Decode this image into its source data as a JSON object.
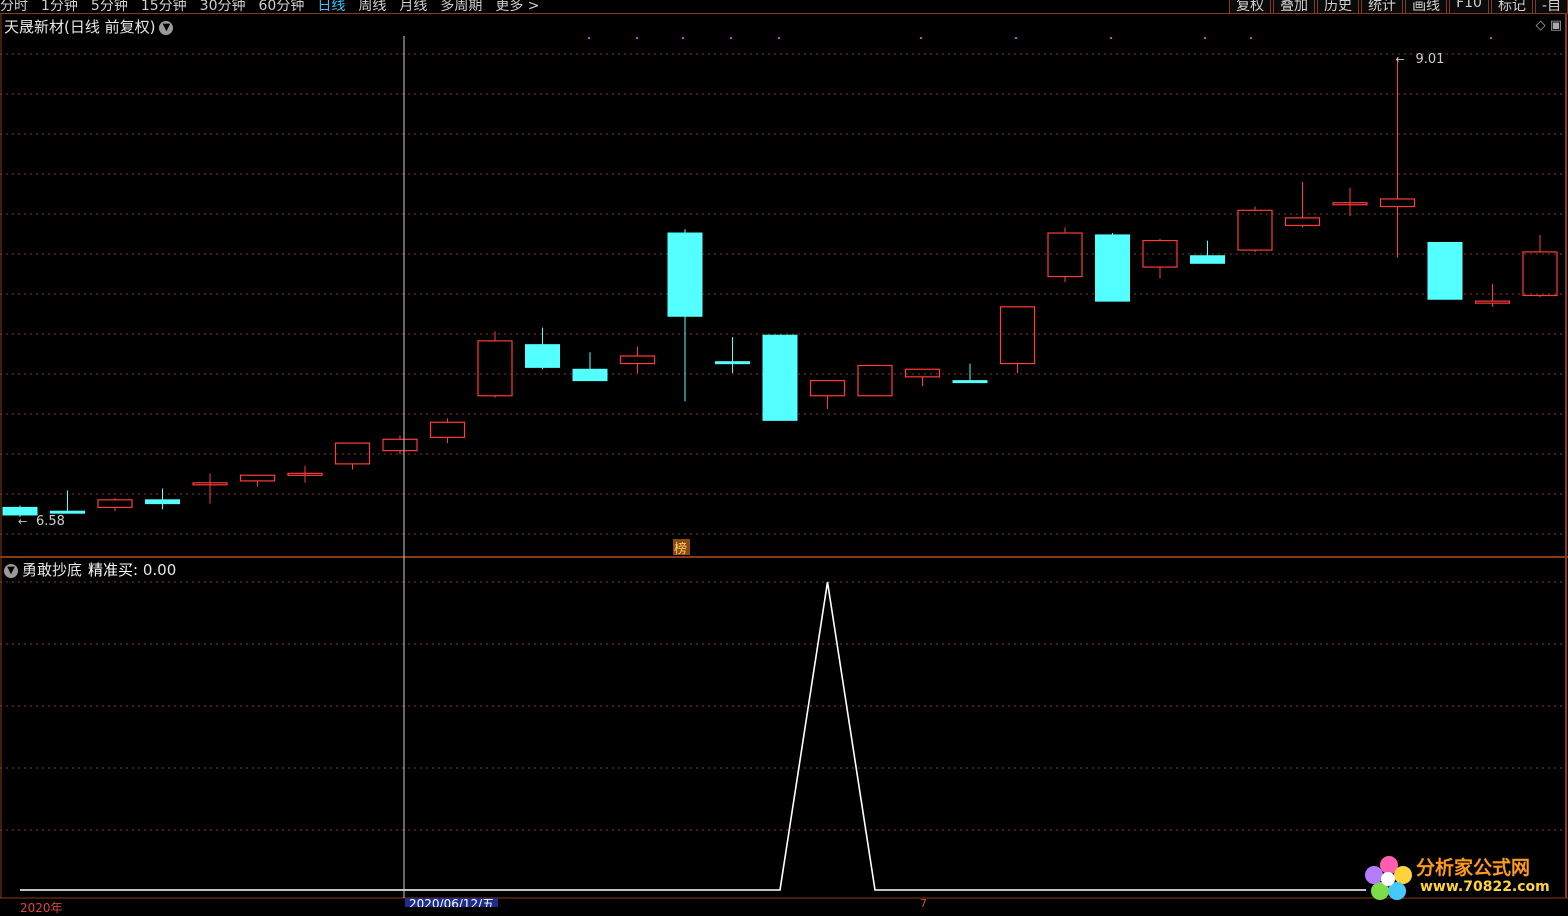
{
  "toolbar": {
    "periods": [
      "分时",
      "1分钟",
      "5分钟",
      "15分钟",
      "30分钟",
      "60分钟",
      "日线",
      "周线",
      "月线",
      "多周期",
      "更多 >"
    ],
    "active_period": "日线",
    "buttons": [
      "复权",
      "叠加",
      "历史",
      "统计",
      "画线",
      "F10",
      "标记",
      "-自"
    ]
  },
  "price_panel": {
    "title": "天晟新材(日线 前复权)",
    "high_label": "9.01",
    "low_label": "6.58",
    "badge": "榜"
  },
  "indicator_panel": {
    "name": "勇敢抄底",
    "line_label": "精准买:",
    "line_value": "0.00"
  },
  "timeline": {
    "year_label": "2020年",
    "selected_date": "2020/06/12/五",
    "marker": "7"
  },
  "watermark": {
    "name": "分析家公式网",
    "url": "www.70822.com"
  },
  "colors": {
    "up": "#ff3b3b",
    "down": "#54ffff",
    "grid": "#8a3a1a",
    "crosshair": "#cccccc"
  },
  "chart_data": {
    "type": "candlestick",
    "ylim": [
      6.5,
      9.1
    ],
    "candles": [
      {
        "o": 6.63,
        "h": 6.64,
        "l": 6.58,
        "c": 6.59
      },
      {
        "o": 6.61,
        "h": 6.72,
        "l": 6.6,
        "c": 6.6
      },
      {
        "o": 6.63,
        "h": 6.68,
        "l": 6.61,
        "c": 6.67
      },
      {
        "o": 6.67,
        "h": 6.73,
        "l": 6.62,
        "c": 6.65
      },
      {
        "o": 6.76,
        "h": 6.81,
        "l": 6.65,
        "c": 6.76
      },
      {
        "o": 6.77,
        "h": 6.8,
        "l": 6.74,
        "c": 6.8
      },
      {
        "o": 6.81,
        "h": 6.85,
        "l": 6.76,
        "c": 6.81
      },
      {
        "o": 6.86,
        "h": 6.96,
        "l": 6.83,
        "c": 6.97
      },
      {
        "o": 6.93,
        "h": 7.01,
        "l": 6.91,
        "c": 6.99
      },
      {
        "o": 7.0,
        "h": 7.1,
        "l": 6.97,
        "c": 7.08
      },
      {
        "o": 7.22,
        "h": 7.56,
        "l": 7.21,
        "c": 7.51
      },
      {
        "o": 7.49,
        "h": 7.58,
        "l": 7.36,
        "c": 7.37
      },
      {
        "o": 7.36,
        "h": 7.45,
        "l": 7.34,
        "c": 7.3
      },
      {
        "o": 7.39,
        "h": 7.48,
        "l": 7.34,
        "c": 7.43
      },
      {
        "o": 8.08,
        "h": 8.1,
        "l": 7.19,
        "c": 7.64
      },
      {
        "o": 7.4,
        "h": 7.53,
        "l": 7.34,
        "c": 7.39
      },
      {
        "o": 7.54,
        "h": 7.54,
        "l": 7.2,
        "c": 7.09
      },
      {
        "o": 7.22,
        "h": 7.26,
        "l": 7.15,
        "c": 7.3
      },
      {
        "o": 7.22,
        "h": 7.34,
        "l": 7.22,
        "c": 7.38
      },
      {
        "o": 7.32,
        "h": 7.36,
        "l": 7.27,
        "c": 7.36
      },
      {
        "o": 7.3,
        "h": 7.39,
        "l": 7.29,
        "c": 7.29
      },
      {
        "o": 7.39,
        "h": 7.63,
        "l": 7.34,
        "c": 7.69
      },
      {
        "o": 7.85,
        "h": 8.11,
        "l": 7.82,
        "c": 8.08
      },
      {
        "o": 8.07,
        "h": 8.08,
        "l": 8.06,
        "c": 7.72
      },
      {
        "o": 7.9,
        "h": 8.05,
        "l": 7.84,
        "c": 8.04
      },
      {
        "o": 7.96,
        "h": 8.04,
        "l": 7.96,
        "c": 7.92
      },
      {
        "o": 7.99,
        "h": 8.22,
        "l": 7.98,
        "c": 8.2
      },
      {
        "o": 8.12,
        "h": 8.35,
        "l": 8.11,
        "c": 8.16
      },
      {
        "o": 8.24,
        "h": 8.32,
        "l": 8.17,
        "c": 8.24
      },
      {
        "o": 8.22,
        "h": 9.01,
        "l": 7.95,
        "c": 8.26
      },
      {
        "o": 8.03,
        "h": 8.02,
        "l": 7.73,
        "c": 7.73
      },
      {
        "o": 7.71,
        "h": 7.81,
        "l": 7.69,
        "c": 7.72
      },
      {
        "o": 7.75,
        "h": 8.07,
        "l": 7.74,
        "c": 7.98
      }
    ],
    "indicator": {
      "name": "精准买",
      "peak_index": 17,
      "peak_value": 1,
      "baseline": 0
    }
  }
}
